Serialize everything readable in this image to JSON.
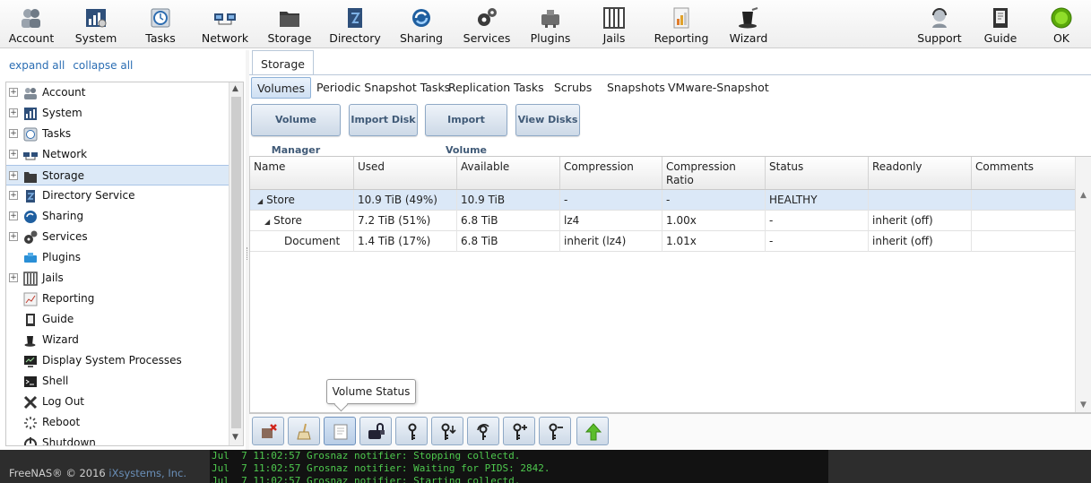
{
  "toolbar": {
    "items": [
      {
        "id": "account",
        "label": "Account",
        "icon": "account-icon"
      },
      {
        "id": "system",
        "label": "System",
        "icon": "system-icon"
      },
      {
        "id": "tasks",
        "label": "Tasks",
        "icon": "tasks-icon"
      },
      {
        "id": "network",
        "label": "Network",
        "icon": "network-icon"
      },
      {
        "id": "storage",
        "label": "Storage",
        "icon": "storage-icon"
      },
      {
        "id": "directory",
        "label": "Directory",
        "icon": "directory-icon"
      },
      {
        "id": "sharing",
        "label": "Sharing",
        "icon": "sharing-icon"
      },
      {
        "id": "services",
        "label": "Services",
        "icon": "services-icon"
      },
      {
        "id": "plugins",
        "label": "Plugins",
        "icon": "plugins-icon"
      },
      {
        "id": "jails",
        "label": "Jails",
        "icon": "jails-icon"
      },
      {
        "id": "reporting",
        "label": "Reporting",
        "icon": "reporting-icon"
      },
      {
        "id": "wizard",
        "label": "Wizard",
        "icon": "wizard-icon"
      },
      {
        "id": "support",
        "label": "Support",
        "icon": "support-icon"
      },
      {
        "id": "guide",
        "label": "Guide",
        "icon": "guide-icon"
      },
      {
        "id": "ok",
        "label": "OK",
        "icon": "status-ok-icon"
      }
    ]
  },
  "tree": {
    "expand_all": "expand all",
    "collapse_all": "collapse all",
    "items": [
      {
        "label": "Account",
        "expandable": true
      },
      {
        "label": "System",
        "expandable": true
      },
      {
        "label": "Tasks",
        "expandable": true
      },
      {
        "label": "Network",
        "expandable": true
      },
      {
        "label": "Storage",
        "expandable": true,
        "selected": true
      },
      {
        "label": "Directory Service",
        "expandable": true
      },
      {
        "label": "Sharing",
        "expandable": true
      },
      {
        "label": "Services",
        "expandable": true
      },
      {
        "label": "Plugins",
        "expandable": false
      },
      {
        "label": "Jails",
        "expandable": true
      },
      {
        "label": "Reporting",
        "expandable": false
      },
      {
        "label": "Guide",
        "expandable": false
      },
      {
        "label": "Wizard",
        "expandable": false
      },
      {
        "label": "Display System Processes",
        "expandable": false
      },
      {
        "label": "Shell",
        "expandable": false
      },
      {
        "label": "Log Out",
        "expandable": false
      },
      {
        "label": "Reboot",
        "expandable": false
      },
      {
        "label": "Shutdown",
        "expandable": false
      }
    ]
  },
  "main": {
    "page_tab": "Storage",
    "subtabs": [
      "Volumes",
      "Periodic Snapshot Tasks",
      "Replication Tasks",
      "Scrubs",
      "Snapshots",
      "VMware-Snapshot"
    ],
    "actions": [
      "Volume Manager",
      "Import Disk",
      "Import Volume",
      "View Disks"
    ],
    "columns": [
      "Name",
      "Used",
      "Available",
      "Compression",
      "Compression Ratio",
      "Status",
      "Readonly",
      "Comments"
    ],
    "rows": [
      {
        "name": "Store",
        "used": "10.9 TiB (49%)",
        "available": "10.9 TiB",
        "compression": "-",
        "ratio": "-",
        "status": "HEALTHY",
        "readonly": "",
        "comments": "",
        "level": 0,
        "expanded": true
      },
      {
        "name": "Store",
        "used": "7.2 TiB (51%)",
        "available": "6.8 TiB",
        "compression": "lz4",
        "ratio": "1.00x",
        "status": "-",
        "readonly": "inherit (off)",
        "comments": "",
        "level": 1,
        "expanded": true
      },
      {
        "name": "Document",
        "used": "1.4 TiB (17%)",
        "available": "6.8 TiB",
        "compression": "inherit (lz4)",
        "ratio": "1.01x",
        "status": "-",
        "readonly": "inherit (off)",
        "comments": "",
        "level": 2,
        "expanded": false
      }
    ],
    "tooltip": "Volume Status",
    "bottom_tools": [
      "detach-volume-icon",
      "scrub-volume-icon",
      "volume-status-icon",
      "encryption-icon",
      "change-passphrase-key-icon",
      "download-key-icon",
      "encryption-rekey-icon",
      "add-recovery-key-icon",
      "remove-recovery-key-icon",
      "upgrade-icon"
    ]
  },
  "footer": {
    "copyright": "FreeNAS® © 2016 ",
    "company": "iXsystems, Inc.",
    "console": [
      "Jul  7 11:02:57 Grosnaz notifier: Stopping collectd.",
      "Jul  7 11:02:57 Grosnaz notifier: Waiting for PIDS: 2842.",
      "Jul  7 11:02:57 Grosnaz notifier: Starting collectd."
    ]
  },
  "colors": {
    "accent": "#2a6db3",
    "selected_row": "#dbe8f7",
    "console_text": "#4ec94e",
    "status_ok": "#7ac70c"
  }
}
